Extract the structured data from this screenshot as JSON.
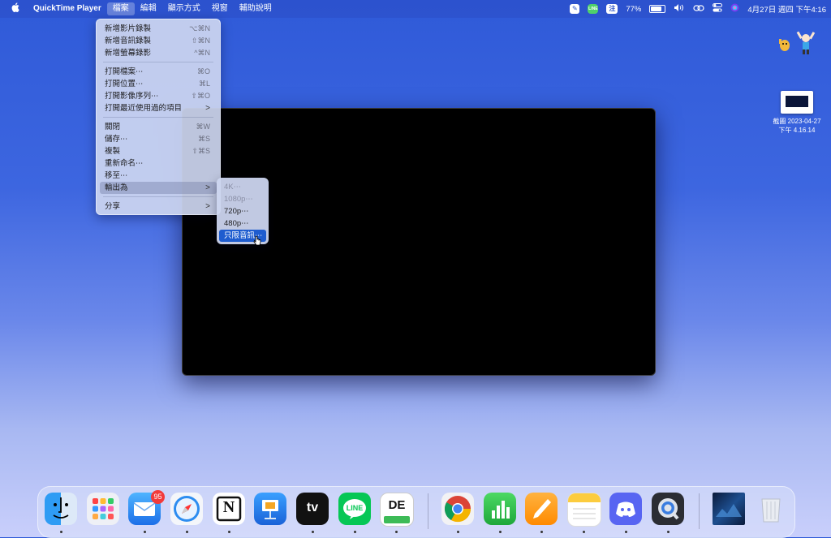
{
  "menubar": {
    "app_name": "QuickTime Player",
    "menus": [
      "檔案",
      "編輯",
      "顯示方式",
      "視窗",
      "輔助說明"
    ],
    "status": {
      "input_method": "注",
      "battery": "77%",
      "battery_level": 0.77,
      "datetime": "4月27日 週四 下午4:16"
    }
  },
  "file_menu": {
    "items": [
      {
        "label": "新增影片錄製",
        "shortcut": "⌥⌘N"
      },
      {
        "label": "新增音訊錄製",
        "shortcut": "⇧⌘N"
      },
      {
        "label": "新增螢幕錄影",
        "shortcut": "^⌘N"
      },
      {
        "label": "打開檔案⋯",
        "shortcut": "⌘O"
      },
      {
        "label": "打開位置⋯",
        "shortcut": "⌘L"
      },
      {
        "label": "打開影像序列⋯",
        "shortcut": "⇧⌘O"
      },
      {
        "label": "打開最近使用過的項目",
        "shortcut": ">"
      },
      {
        "label": "關閉",
        "shortcut": "⌘W"
      },
      {
        "label": "儲存⋯",
        "shortcut": "⌘S"
      },
      {
        "label": "複製",
        "shortcut": "⇧⌘S"
      },
      {
        "label": "重新命名⋯",
        "shortcut": ""
      },
      {
        "label": "移至⋯",
        "shortcut": ""
      },
      {
        "label": "輸出為",
        "shortcut": ">"
      },
      {
        "label": "分享",
        "shortcut": ">"
      }
    ]
  },
  "export_submenu": {
    "items": [
      {
        "label": "4K⋯",
        "enabled": false
      },
      {
        "label": "1080p⋯",
        "enabled": false
      },
      {
        "label": "720p⋯",
        "enabled": true
      },
      {
        "label": "480p⋯",
        "enabled": true
      },
      {
        "label": "只限音訊⋯",
        "enabled": true,
        "selected": true
      }
    ]
  },
  "desktop": {
    "file_name_line1": "截圖 2023-04-27",
    "file_name_line2": "下午 4.16.14"
  },
  "dock": {
    "mail_badge": "95",
    "apps": [
      "finder-icon",
      "launchpad-icon",
      "mail-icon",
      "safari-icon",
      "notion-icon",
      "keynote-icon",
      "apple-tv-icon",
      "line-icon",
      "de-mycoach-icon",
      "chrome-icon",
      "numbers-icon",
      "pages-icon",
      "notes-icon",
      "discord-icon",
      "quicktime-icon",
      "stacks-icon",
      "trash-icon"
    ],
    "tv_label": "tv",
    "line_label": "LINE",
    "notion_label": "N",
    "de_label": "DE"
  }
}
